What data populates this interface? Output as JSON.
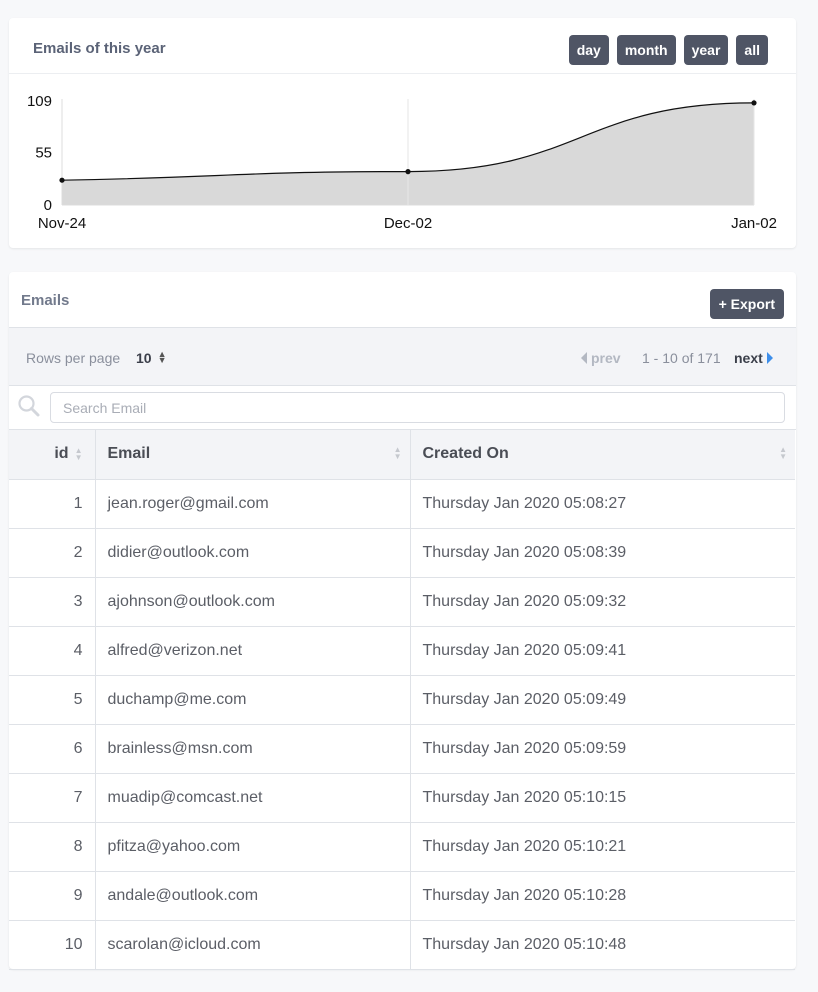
{
  "chart": {
    "title": "Emails of this year",
    "buttons": [
      "day",
      "month",
      "year",
      "all"
    ],
    "colors": {
      "fill": "#d9d9d9",
      "line": "#111111",
      "button_bg": "#4f5565"
    }
  },
  "chart_data": {
    "type": "area",
    "title": "Emails of this year",
    "x": [
      "Nov-24",
      "Dec-02",
      "Jan-02"
    ],
    "values": [
      26,
      35,
      107
    ],
    "yticks": [
      0,
      55,
      109
    ],
    "ylim": [
      0,
      109
    ],
    "xlabel": "",
    "ylabel": "",
    "grid": false
  },
  "table_card": {
    "title": "Emails",
    "export_label": "+ Export",
    "rows_per_page_label": "Rows per page",
    "rows_per_page_value": "10",
    "prev_label": "prev",
    "page_info": "1 - 10 of 171",
    "next_label": "next",
    "search_placeholder": "Search Email",
    "columns": {
      "id": "id",
      "email": "Email",
      "created": "Created On"
    },
    "rows": [
      {
        "id": "1",
        "email": "jean.roger@gmail.com",
        "created": "Thursday Jan 2020 05:08:27"
      },
      {
        "id": "2",
        "email": "didier@outlook.com",
        "created": "Thursday Jan 2020 05:08:39"
      },
      {
        "id": "3",
        "email": "ajohnson@outlook.com",
        "created": "Thursday Jan 2020 05:09:32"
      },
      {
        "id": "4",
        "email": "alfred@verizon.net",
        "created": "Thursday Jan 2020 05:09:41"
      },
      {
        "id": "5",
        "email": "duchamp@me.com",
        "created": "Thursday Jan 2020 05:09:49"
      },
      {
        "id": "6",
        "email": "brainless@msn.com",
        "created": "Thursday Jan 2020 05:09:59"
      },
      {
        "id": "7",
        "email": "muadip@comcast.net",
        "created": "Thursday Jan 2020 05:10:15"
      },
      {
        "id": "8",
        "email": "pfitza@yahoo.com",
        "created": "Thursday Jan 2020 05:10:21"
      },
      {
        "id": "9",
        "email": "andale@outlook.com",
        "created": "Thursday Jan 2020 05:10:28"
      },
      {
        "id": "10",
        "email": "scarolan@icloud.com",
        "created": "Thursday Jan 2020 05:10:48"
      }
    ]
  }
}
